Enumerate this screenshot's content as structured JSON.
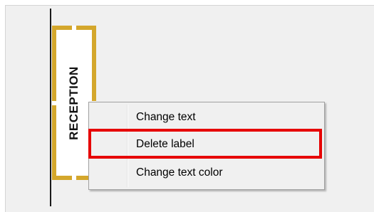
{
  "floorplan": {
    "room_label": "RECEPTION",
    "label_border_color": "#d4a72c"
  },
  "context_menu": {
    "items": [
      {
        "label": "Change text"
      },
      {
        "label": "Delete label"
      },
      {
        "label": "Change text color"
      }
    ]
  },
  "annotation": {
    "highlight_color": "#e60000",
    "highlighted_item": "Delete label"
  }
}
